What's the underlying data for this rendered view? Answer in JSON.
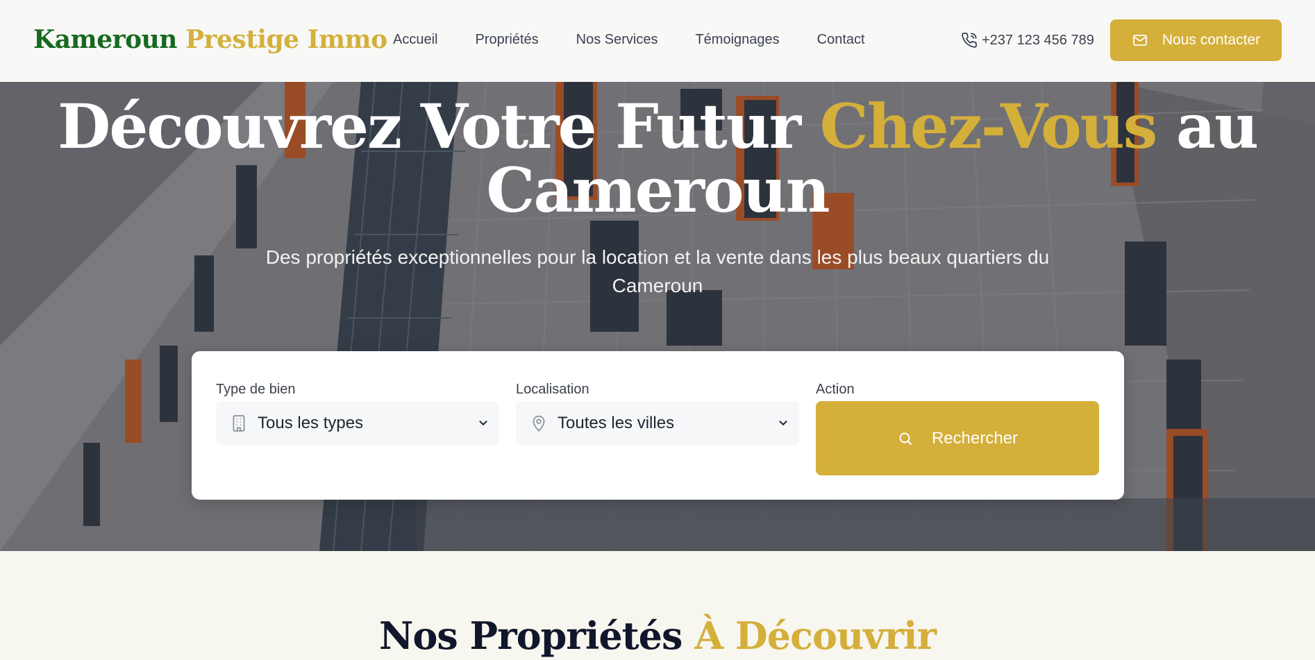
{
  "header": {
    "logo_part1": "Kameroun",
    "logo_part2": "Prestige Immo",
    "nav": [
      "Accueil",
      "Propriétés",
      "Nos Services",
      "Témoignages",
      "Contact"
    ],
    "phone": "+237 123 456 789",
    "phone_icon": "phone-icon",
    "contact_button": "Nous contacter",
    "contact_icon": "mail-icon"
  },
  "hero": {
    "title_part1": "Découvrez Votre Futur ",
    "title_highlight": "Chez-Vous",
    "title_part2": " au Cameroun",
    "subtitle": "Des propriétés exceptionnelles pour la location et la vente dans les plus beaux quartiers du Cameroun"
  },
  "search": {
    "type_label": "Type de bien",
    "type_value": "Tous les types",
    "type_icon": "building-icon",
    "location_label": "Localisation",
    "location_value": "Toutes les villes",
    "location_icon": "map-pin-icon",
    "action_label": "Action",
    "search_button": "Rechercher",
    "search_icon": "search-icon"
  },
  "section": {
    "title_part1": "Nos Propriétés ",
    "title_highlight": "À Découvrir"
  },
  "colors": {
    "gold": "#d4af3a",
    "green": "#17691f",
    "dark": "#11172a"
  }
}
